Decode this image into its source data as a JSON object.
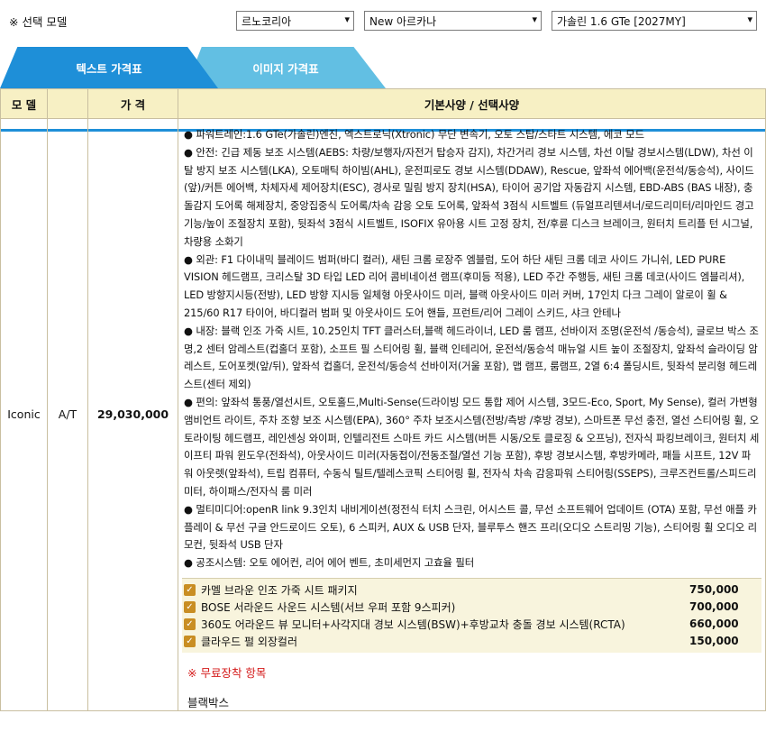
{
  "header": {
    "title": "※ 선택 모델",
    "brand_select": "르노코리아",
    "model_select": "New 아르카나",
    "trim_select": "가솔린 1.6 GTe [2027MY]"
  },
  "tabs": [
    {
      "label": "텍스트 가격표"
    },
    {
      "label": "이미지 가격표"
    }
  ],
  "table": {
    "headers": {
      "model": "모 델",
      "price": "가 격",
      "spec": "기본사양 / 선택사양"
    },
    "row": {
      "model": "Iconic",
      "transmission": "A/T",
      "price": "29,030,000",
      "basic_specs": [
        "● 파워트레인:1.6 GTe(가솔린)엔진, 엑스트로닉(Xtronic) 무단 변속기, 오토 스탑/스타트 시스템, 에코 모드",
        "● 안전: 긴급 제동 보조 시스템(AEBS: 차량/보행자/자전거 탑승자 감지), 차간거리 경보 시스템, 차선 이탈 경보시스템(LDW), 차선 이탈 방지 보조 시스템(LKA), 오토매틱 하이빔(AHL), 운전피로도 경보 시스템(DDAW), Rescue, 앞좌석 에어백(운전석/동승석), 사이드(앞)/커튼 에어백, 차체자세 제어장치(ESC), 경사로 밀림 방지 장치(HSA), 타이어 공기압 자동감지 시스템, EBD-ABS (BAS 내장), 충돌감지 도어록 해제장치, 중앙집중식 도어록/차속 감응 오토 도어록, 앞좌석 3점식 시트벨트 (듀얼프리텐셔너/로드리미터/리마인드 경고 기능/높이 조절장치 포함), 뒷좌석 3점식 시트벨트, ISOFIX 유아용 시트 고정 장치, 전/후륜 디스크 브레이크, 원터치 트리플 턴 시그널, 차량용 소화기",
        "● 외관: F1 다이내믹 블레이드 범퍼(바디 컬러), 새틴 크롬 로장주 엠블럼, 도어 하단 새틴 크롬 데코 사이드 가니쉬, LED PURE VISION 헤드램프, 크리스탈 3D 타입 LED 리어 콤비네이션 램프(후미등 적용), LED 주간 주행등, 새틴 크롬 데코(사이드 엠블리셔), LED 방향지시등(전방), LED 방향 지시등 일체형 아웃사이드 미러, 블랙 아웃사이드 미러 커버, 17인치 다크 그레이 알로이 휠 & 215/60 R17 타이어, 바디컬러 범퍼 및 아웃사이드 도어 핸들, 프런트/리어 그레이 스키드, 샤크 안테나",
        "● 내장: 블랙 인조 가죽 시트, 10.25인치 TFT 클러스터,블랙 헤드라이너, LED 룸 램프, 선바이저 조명(운전석 /동승석), 글로브 박스 조명,2 센터 암레스트(컵홀더 포함), 소프트 필 스티어링 휠, 블랙 인테리어, 운전석/동승석 매뉴얼 시트 높이 조절장치, 앞좌석 슬라이딩 암레스트, 도어포켓(앞/뒤), 앞좌석 컵홀더, 운전석/동승석 선바이저(거울 포함), 맵 램프, 룸램프, 2열 6:4 폴딩시트, 뒷좌석 분리형 헤드레스트(센터 제외)",
        "● 편의: 앞좌석 통풍/열선시트, 오토홀드,Multi-Sense(드라이빙 모드 통합 제어 시스템, 3모드-Eco, Sport, My Sense), 컬러 가변형 앰비언트 라이트, 주차 조향 보조 시스템(EPA), 360° 주차 보조시스템(전방/측방 /후방 경보), 스마트폰 무선 충전, 열선 스티어링 휠, 오토라이팅 헤드램프, 레인센싱 와이퍼, 인텔리전트 스마트 카드 시스템(버튼 시동/오토 클로징 & 오프닝), 전자식 파킹브레이크, 원터치 세이프티 파워 윈도우(전좌석), 아웃사이드 미러(자동접이/전동조절/열선 기능 포함), 후방 경보시스템, 후방카메라, 패들 시프트, 12V 파워 아웃렛(앞좌석), 트립 컴퓨터, 수동식 틸트/텔레스코픽 스티어링 휠, 전자식 차속 감응파워 스티어링(SSEPS), 크루즈컨트롤/스피드리미터, 하이패스/전자식 룸 미러",
        "● 멀티미디어:openR link 9.3인치 내비게이션(정전식 터치 스크린, 어시스트 콜, 무선 소프트웨어 업데이트 (OTA) 포함, 무선 애플 카플레이 & 무선 구글 안드로이드 오토), 6 스피커, AUX & USB 단자, 블루투스 핸즈 프리(오디오 스트리밍 기능), 스티어링 휠 오디오 리모컨, 뒷좌석 USB 단자",
        "● 공조시스템: 오토 에어컨, 리어 에어 벤트, 초미세먼지 고효율 필터"
      ],
      "options": [
        {
          "name": "카멜 브라운 인조 가죽 시트 패키지",
          "price": "750,000"
        },
        {
          "name": "BOSE 서라운드 사운드 시스템(서브 우퍼 포함 9스피커)",
          "price": "700,000"
        },
        {
          "name": "360도 어라운드 뷰 모니터+사각지대 경보 시스템(BSW)+후방교차 충돌 경보 시스템(RCTA)",
          "price": "660,000"
        },
        {
          "name": "클라우드 펄 외장컬러",
          "price": "150,000"
        }
      ],
      "free_title": "※ 무료장착 항목",
      "free_items": [
        "블랙박스"
      ]
    }
  },
  "colors": {
    "tab_active": "#1e8fd8",
    "tab_inactive": "#62bfe3",
    "header_bg": "#f7f0c4",
    "checkbox": "#c98e23",
    "free_title": "#d41a1a"
  }
}
